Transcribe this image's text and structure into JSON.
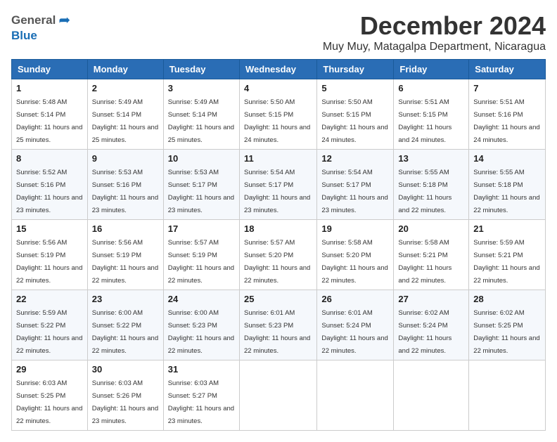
{
  "header": {
    "logo_general": "General",
    "logo_blue": "Blue",
    "month_title": "December 2024",
    "location": "Muy Muy, Matagalpa Department, Nicaragua"
  },
  "days_of_week": [
    "Sunday",
    "Monday",
    "Tuesday",
    "Wednesday",
    "Thursday",
    "Friday",
    "Saturday"
  ],
  "weeks": [
    [
      {
        "day": "1",
        "sunrise": "Sunrise: 5:48 AM",
        "sunset": "Sunset: 5:14 PM",
        "daylight": "Daylight: 11 hours and 25 minutes."
      },
      {
        "day": "2",
        "sunrise": "Sunrise: 5:49 AM",
        "sunset": "Sunset: 5:14 PM",
        "daylight": "Daylight: 11 hours and 25 minutes."
      },
      {
        "day": "3",
        "sunrise": "Sunrise: 5:49 AM",
        "sunset": "Sunset: 5:14 PM",
        "daylight": "Daylight: 11 hours and 25 minutes."
      },
      {
        "day": "4",
        "sunrise": "Sunrise: 5:50 AM",
        "sunset": "Sunset: 5:15 PM",
        "daylight": "Daylight: 11 hours and 24 minutes."
      },
      {
        "day": "5",
        "sunrise": "Sunrise: 5:50 AM",
        "sunset": "Sunset: 5:15 PM",
        "daylight": "Daylight: 11 hours and 24 minutes."
      },
      {
        "day": "6",
        "sunrise": "Sunrise: 5:51 AM",
        "sunset": "Sunset: 5:15 PM",
        "daylight": "Daylight: 11 hours and 24 minutes."
      },
      {
        "day": "7",
        "sunrise": "Sunrise: 5:51 AM",
        "sunset": "Sunset: 5:16 PM",
        "daylight": "Daylight: 11 hours and 24 minutes."
      }
    ],
    [
      {
        "day": "8",
        "sunrise": "Sunrise: 5:52 AM",
        "sunset": "Sunset: 5:16 PM",
        "daylight": "Daylight: 11 hours and 23 minutes."
      },
      {
        "day": "9",
        "sunrise": "Sunrise: 5:53 AM",
        "sunset": "Sunset: 5:16 PM",
        "daylight": "Daylight: 11 hours and 23 minutes."
      },
      {
        "day": "10",
        "sunrise": "Sunrise: 5:53 AM",
        "sunset": "Sunset: 5:17 PM",
        "daylight": "Daylight: 11 hours and 23 minutes."
      },
      {
        "day": "11",
        "sunrise": "Sunrise: 5:54 AM",
        "sunset": "Sunset: 5:17 PM",
        "daylight": "Daylight: 11 hours and 23 minutes."
      },
      {
        "day": "12",
        "sunrise": "Sunrise: 5:54 AM",
        "sunset": "Sunset: 5:17 PM",
        "daylight": "Daylight: 11 hours and 23 minutes."
      },
      {
        "day": "13",
        "sunrise": "Sunrise: 5:55 AM",
        "sunset": "Sunset: 5:18 PM",
        "daylight": "Daylight: 11 hours and 22 minutes."
      },
      {
        "day": "14",
        "sunrise": "Sunrise: 5:55 AM",
        "sunset": "Sunset: 5:18 PM",
        "daylight": "Daylight: 11 hours and 22 minutes."
      }
    ],
    [
      {
        "day": "15",
        "sunrise": "Sunrise: 5:56 AM",
        "sunset": "Sunset: 5:19 PM",
        "daylight": "Daylight: 11 hours and 22 minutes."
      },
      {
        "day": "16",
        "sunrise": "Sunrise: 5:56 AM",
        "sunset": "Sunset: 5:19 PM",
        "daylight": "Daylight: 11 hours and 22 minutes."
      },
      {
        "day": "17",
        "sunrise": "Sunrise: 5:57 AM",
        "sunset": "Sunset: 5:19 PM",
        "daylight": "Daylight: 11 hours and 22 minutes."
      },
      {
        "day": "18",
        "sunrise": "Sunrise: 5:57 AM",
        "sunset": "Sunset: 5:20 PM",
        "daylight": "Daylight: 11 hours and 22 minutes."
      },
      {
        "day": "19",
        "sunrise": "Sunrise: 5:58 AM",
        "sunset": "Sunset: 5:20 PM",
        "daylight": "Daylight: 11 hours and 22 minutes."
      },
      {
        "day": "20",
        "sunrise": "Sunrise: 5:58 AM",
        "sunset": "Sunset: 5:21 PM",
        "daylight": "Daylight: 11 hours and 22 minutes."
      },
      {
        "day": "21",
        "sunrise": "Sunrise: 5:59 AM",
        "sunset": "Sunset: 5:21 PM",
        "daylight": "Daylight: 11 hours and 22 minutes."
      }
    ],
    [
      {
        "day": "22",
        "sunrise": "Sunrise: 5:59 AM",
        "sunset": "Sunset: 5:22 PM",
        "daylight": "Daylight: 11 hours and 22 minutes."
      },
      {
        "day": "23",
        "sunrise": "Sunrise: 6:00 AM",
        "sunset": "Sunset: 5:22 PM",
        "daylight": "Daylight: 11 hours and 22 minutes."
      },
      {
        "day": "24",
        "sunrise": "Sunrise: 6:00 AM",
        "sunset": "Sunset: 5:23 PM",
        "daylight": "Daylight: 11 hours and 22 minutes."
      },
      {
        "day": "25",
        "sunrise": "Sunrise: 6:01 AM",
        "sunset": "Sunset: 5:23 PM",
        "daylight": "Daylight: 11 hours and 22 minutes."
      },
      {
        "day": "26",
        "sunrise": "Sunrise: 6:01 AM",
        "sunset": "Sunset: 5:24 PM",
        "daylight": "Daylight: 11 hours and 22 minutes."
      },
      {
        "day": "27",
        "sunrise": "Sunrise: 6:02 AM",
        "sunset": "Sunset: 5:24 PM",
        "daylight": "Daylight: 11 hours and 22 minutes."
      },
      {
        "day": "28",
        "sunrise": "Sunrise: 6:02 AM",
        "sunset": "Sunset: 5:25 PM",
        "daylight": "Daylight: 11 hours and 22 minutes."
      }
    ],
    [
      {
        "day": "29",
        "sunrise": "Sunrise: 6:03 AM",
        "sunset": "Sunset: 5:25 PM",
        "daylight": "Daylight: 11 hours and 22 minutes."
      },
      {
        "day": "30",
        "sunrise": "Sunrise: 6:03 AM",
        "sunset": "Sunset: 5:26 PM",
        "daylight": "Daylight: 11 hours and 23 minutes."
      },
      {
        "day": "31",
        "sunrise": "Sunrise: 6:03 AM",
        "sunset": "Sunset: 5:27 PM",
        "daylight": "Daylight: 11 hours and 23 minutes."
      },
      null,
      null,
      null,
      null
    ]
  ]
}
